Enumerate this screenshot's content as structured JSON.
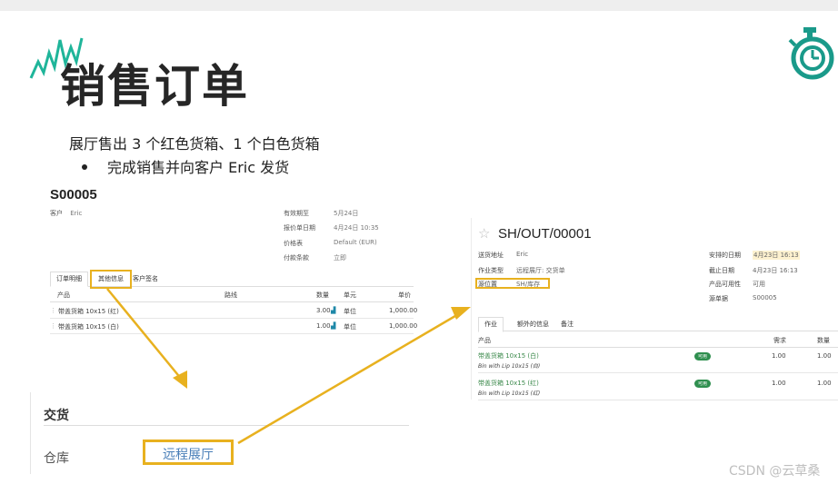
{
  "slide": {
    "title": "销售订单",
    "line1": "展厅售出 3 个红色货箱、1 个白色货箱",
    "bullet": "完成销售并向客户 Eric 发货",
    "watermark": "CSDN @云草桑"
  },
  "colors": {
    "accent": "#e8b11f",
    "logo": "#1a9a8a",
    "sparks": "#1fb59a",
    "link": "#4a7fb8",
    "badge": "#2f8f4f"
  },
  "order": {
    "ref": "S00005",
    "customer_label": "客户",
    "customer_value": "Eric",
    "fields": [
      {
        "label": "有效期至",
        "value": "5月24日"
      },
      {
        "label": "报价单日期",
        "value": "4月24日 10:35"
      },
      {
        "label": "价格表",
        "value": "Default (EUR)"
      },
      {
        "label": "付款条款",
        "value": "立即"
      }
    ],
    "tabs": [
      "订单明细",
      "其他信息",
      "客户签名"
    ],
    "columns": [
      "产品",
      "路线",
      "数量",
      "单元",
      "单价"
    ],
    "rows": [
      {
        "product": "带盖货箱 10x15 (红)",
        "qty": "3.00",
        "unit": "单位",
        "price": "1,000.00"
      },
      {
        "product": "带盖货箱 10x15 (白)",
        "qty": "1.00",
        "unit": "单位",
        "price": "1,000.00"
      }
    ]
  },
  "delivery": {
    "heading": "交货",
    "warehouse_label": "仓库",
    "warehouse_value": "远程展厅"
  },
  "picking": {
    "ref": "SH/OUT/00001",
    "fields_left": [
      {
        "label": "送货地址",
        "value": "Eric"
      },
      {
        "label": "作业类型",
        "value": "远程展厅: 交货单"
      },
      {
        "label": "源位置",
        "value": "SH/库存"
      }
    ],
    "fields_right": [
      {
        "label": "安排的日期",
        "value": "4月23日 16:13"
      },
      {
        "label": "截止日期",
        "value": "4月23日 16:13"
      },
      {
        "label": "产品可用性",
        "value": "可用"
      },
      {
        "label": "源单据",
        "value": "S00005"
      }
    ],
    "tabs": [
      "作业",
      "额外的信息",
      "备注"
    ],
    "columns": [
      "产品",
      "需求",
      "数量"
    ],
    "rows": [
      {
        "product": "带盖货箱 10x15 (白)",
        "desc": "Bin with Lip 10x15 (白)",
        "badge": "可用",
        "demand": "1.00",
        "qty": "1.00"
      },
      {
        "product": "带盖货箱 10x15 (红)",
        "desc": "Bin with Lip 10x15 (红)",
        "badge": "可用",
        "demand": "1.00",
        "qty": "1.00"
      }
    ]
  }
}
